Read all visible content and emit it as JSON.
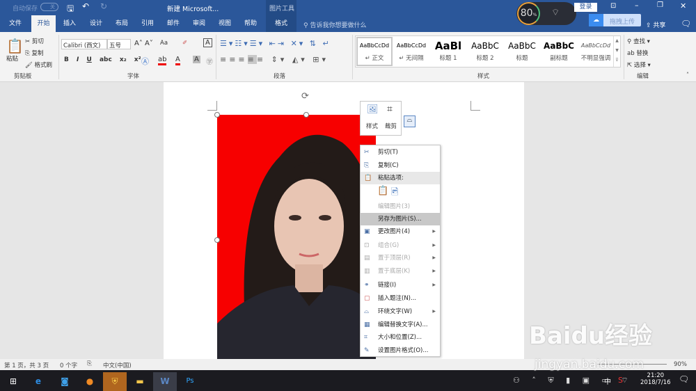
{
  "title_bar": {
    "autosave_label": "自动保存",
    "autosave_state": "关",
    "doc_title": "新建 Microsoft...",
    "context_tab_group": "图片工具",
    "login": "登录",
    "battery": "80",
    "battery_unit": "%",
    "upload": "拖拽上传",
    "share": "共享"
  },
  "tabs": [
    "文件",
    "开始",
    "插入",
    "设计",
    "布局",
    "引用",
    "邮件",
    "审阅",
    "视图",
    "帮助",
    "格式"
  ],
  "tell_me": "告诉我你想要做什么",
  "clipboard": {
    "paste": "粘贴",
    "cut": "剪切",
    "copy": "复制",
    "format_painter": "格式刷",
    "group": "剪贴板"
  },
  "font": {
    "name": "Calibri (西文)",
    "size": "五号",
    "aa": "Aa",
    "group": "字体"
  },
  "paragraph": {
    "group": "段落"
  },
  "styles": {
    "items": [
      {
        "preview": "AaBbCcDd",
        "label": "↵ 正文"
      },
      {
        "preview": "AaBbCcDd",
        "label": "↵ 无间隔"
      },
      {
        "preview": "AaBl",
        "label": "标题 1"
      },
      {
        "preview": "AaBbC",
        "label": "标题 2"
      },
      {
        "preview": "AaBbC",
        "label": "标题"
      },
      {
        "preview": "AaBbC",
        "label": "副标题"
      },
      {
        "preview": "AaBbCcDd",
        "label": "不明显强调"
      }
    ],
    "group": "样式"
  },
  "editing": {
    "find": "查找",
    "replace": "替换",
    "select": "选择",
    "group": "编辑"
  },
  "mini_toolbar": {
    "style": "样式",
    "crop": "裁剪"
  },
  "context_menu": {
    "items": [
      {
        "label": "剪切(T)",
        "icon": "✂",
        "state": "normal"
      },
      {
        "label": "复制(C)",
        "icon": "⎘",
        "state": "normal"
      },
      {
        "label": "粘贴选项:",
        "icon": "📋",
        "state": "header"
      },
      {
        "label": "编辑图片(3)",
        "icon": "",
        "state": "disabled"
      },
      {
        "label": "另存为图片(S)...",
        "icon": "",
        "state": "highlighted"
      },
      {
        "label": "更改图片(4)",
        "icon": "▣",
        "state": "submenu"
      },
      {
        "label": "组合(G)",
        "icon": "⊡",
        "state": "disabled-submenu"
      },
      {
        "label": "置于顶层(R)",
        "icon": "▤",
        "state": "disabled-submenu"
      },
      {
        "label": "置于底层(K)",
        "icon": "▥",
        "state": "disabled-submenu"
      },
      {
        "label": "链接(I)",
        "icon": "⚭",
        "state": "submenu"
      },
      {
        "label": "插入题注(N)...",
        "icon": "▢",
        "state": "normal"
      },
      {
        "label": "环绕文字(W)",
        "icon": "⌓",
        "state": "submenu"
      },
      {
        "label": "编辑替换文字(A)...",
        "icon": "▦",
        "state": "normal"
      },
      {
        "label": "大小和位置(Z)...",
        "icon": "⌗",
        "state": "normal"
      },
      {
        "label": "设置图片格式(O)...",
        "icon": "✎",
        "state": "normal"
      }
    ]
  },
  "status_bar": {
    "page": "第 1 页，共 3 页",
    "words": "0 个字",
    "language": "中文(中国)",
    "zoom": "90%"
  },
  "taskbar": {
    "time": "21:20",
    "date": "2018/7/16",
    "ime": "中"
  },
  "watermark": {
    "brand": "Baidu经验",
    "url": "jingyan.baidu.com"
  }
}
